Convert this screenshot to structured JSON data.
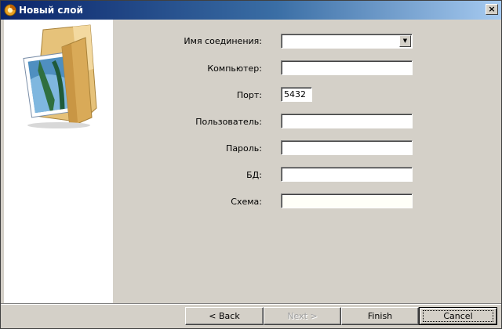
{
  "window": {
    "title": "Новый слой",
    "close_glyph": "×"
  },
  "form": {
    "fields": [
      {
        "label": "Имя соединения:",
        "value": "",
        "type": "combo"
      },
      {
        "label": "Компьютер:",
        "value": ""
      },
      {
        "label": "Порт:",
        "value": "5432"
      },
      {
        "label": "Пользователь:",
        "value": ""
      },
      {
        "label": "Пароль:",
        "value": ""
      },
      {
        "label": "БД:",
        "value": ""
      },
      {
        "label": "Схема:",
        "value": ""
      }
    ]
  },
  "buttons": {
    "back": "< Back",
    "next": "Next >",
    "finish": "Finish",
    "cancel": "Cancel"
  },
  "icons": {
    "title_icon": "app-logo-icon",
    "folder_icon": "folder-image-icon",
    "dropdown": "chevron-down-icon"
  }
}
